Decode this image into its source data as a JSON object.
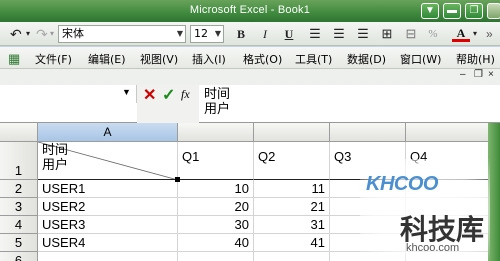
{
  "window": {
    "title": "Microsoft Excel - Book1"
  },
  "toolbar": {
    "font_name": "宋体",
    "font_size": "12",
    "bold": "B",
    "italic": "I",
    "underline": "U",
    "font_color_label": "A",
    "percent": "%"
  },
  "menu": {
    "items": [
      "文件(F)",
      "编辑(E)",
      "视图(V)",
      "插入(I)",
      "格式(O)",
      "工具(T)",
      "数据(D)",
      "窗口(W)",
      "帮助(H)"
    ]
  },
  "formula_bar": {
    "name_box": "",
    "fx_label": "fx",
    "content_line1": "时间",
    "content_line2": "用户"
  },
  "sheet": {
    "active_column": "A",
    "columns": [
      "A",
      "",
      "",
      "",
      ""
    ],
    "row_numbers": [
      "1",
      "2",
      "3",
      "4",
      "5",
      "6"
    ],
    "header_row": {
      "a_line1": "时间",
      "a_line2": "用户",
      "q1": "Q1",
      "q2": "Q2",
      "q3": "Q3",
      "q4": "Q4"
    },
    "rows": [
      {
        "user": "USER1",
        "q1": "10",
        "q2": "11"
      },
      {
        "user": "USER2",
        "q1": "20",
        "q2": "21"
      },
      {
        "user": "USER3",
        "q1": "30",
        "q2": "31"
      },
      {
        "user": "USER4",
        "q1": "40",
        "q2": "41"
      }
    ]
  },
  "watermark": {
    "brand": "KHCOO",
    "name": "科技库",
    "url": "khcoo.com"
  },
  "colors": {
    "title_bar": "#3f8a3e",
    "header_active": "#a8c5e6",
    "watermark_blue": "#4a8fd0"
  }
}
